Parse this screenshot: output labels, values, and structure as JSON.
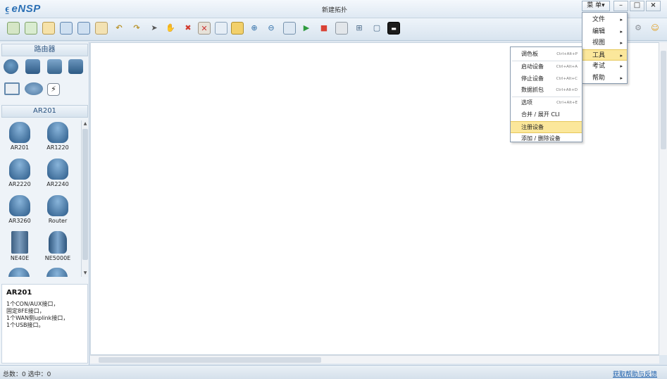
{
  "app": {
    "logo": "eNSP",
    "title": "新建拓扑",
    "menu_label": "菜 单▾",
    "win_min": "–",
    "win_max": "□",
    "win_close": "×"
  },
  "toolbar": {
    "icons": [
      "new-topology-icon",
      "new-example-icon",
      "open-icon",
      "save-icon",
      "save-as-icon",
      "print-icon",
      "undo-icon",
      "redo-icon",
      "select-pointer-icon",
      "hand-pan-icon",
      "delete-icon",
      "delete-link-icon",
      "text-icon",
      "palette-icon",
      "zoom-in-icon",
      "zoom-out-icon",
      "fit-icon",
      "start-device-icon",
      "stop-device-icon",
      "capture-icon",
      "topology-icon",
      "fullscreen-icon",
      "console-icon"
    ]
  },
  "left_panel": {
    "section1_title": "路由器",
    "section2_title": "AR201",
    "devices": [
      {
        "name": "AR201"
      },
      {
        "name": "AR1220"
      },
      {
        "name": "AR2220"
      },
      {
        "name": "AR2240"
      },
      {
        "name": "AR3260"
      },
      {
        "name": "Router"
      },
      {
        "name": "NE40E"
      },
      {
        "name": "NE5000E"
      }
    ],
    "desc_title": "AR201",
    "desc_body": "1个CON/AUX接口，\n固定8FE接口，\n1个WAN侧uplink接口，\n1个USB接口。"
  },
  "main_menu": {
    "items": [
      {
        "label": "文件",
        "arrow": "▸"
      },
      {
        "label": "编辑",
        "arrow": "▸"
      },
      {
        "label": "视图",
        "arrow": "▸"
      },
      {
        "label": "工具",
        "arrow": "▸"
      },
      {
        "label": "考试",
        "arrow": "▸"
      },
      {
        "label": "帮助",
        "arrow": "▸"
      }
    ],
    "highlighted": "工具"
  },
  "sub_menu": {
    "items": [
      {
        "label": "调色板",
        "shortcut": "Ctrl+Alt+P"
      },
      {
        "label": "启动设备",
        "shortcut": "Ctrl+Alt+A"
      },
      {
        "label": "停止设备",
        "shortcut": "Ctrl+Alt+C"
      },
      {
        "label": "数据抓包",
        "shortcut": "Ctrl+Alt+D"
      },
      {
        "label": "选项",
        "shortcut": "Ctrl+Alt+E"
      },
      {
        "label": "合并 / 展开 CLI",
        "shortcut": ""
      },
      {
        "label": "注册设备",
        "shortcut": ""
      },
      {
        "label": "添加 / 删除设备",
        "shortcut": ""
      }
    ],
    "highlighted": "注册设备"
  },
  "statusbar": {
    "text": "总数：0  选中：0",
    "help_link": "获取帮助与反馈"
  },
  "colors": {
    "accent": "#2a6fb4",
    "highlight": "#fbe79b"
  }
}
